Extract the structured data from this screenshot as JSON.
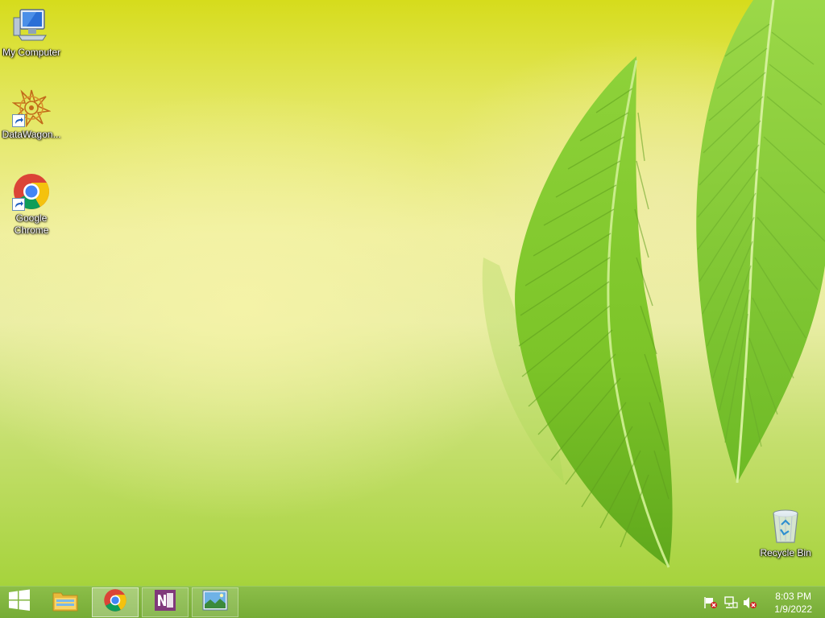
{
  "desktop": {
    "icons": [
      {
        "label": "My Computer",
        "icon": "computer-icon"
      },
      {
        "label": "DataWagon...",
        "icon": "datawagon-icon",
        "shortcut": true
      },
      {
        "label": "Google Chrome",
        "icon": "chrome-icon",
        "shortcut": true
      },
      {
        "label": "Recycle Bin",
        "icon": "recycle-bin-icon"
      }
    ]
  },
  "taskbar": {
    "start_icon": "windows-logo-icon",
    "apps": [
      {
        "name": "file-explorer",
        "icon": "folder-icon",
        "state": "pinned"
      },
      {
        "name": "google-chrome",
        "icon": "chrome-icon",
        "state": "active"
      },
      {
        "name": "onenote",
        "icon": "onenote-icon",
        "state": "pinned"
      },
      {
        "name": "image-viewer",
        "icon": "picture-icon",
        "state": "pinned"
      }
    ],
    "tray": {
      "icons": [
        "action-center-flag-icon",
        "network-icon",
        "volume-muted-icon"
      ],
      "time": "8:03 PM",
      "date": "1/9/2022"
    }
  },
  "colors": {
    "taskbar": "#7fb43e",
    "onenote": "#80397b",
    "chrome_red": "#db4437",
    "chrome_yellow": "#f4c20d",
    "chrome_green": "#0f9d58",
    "chrome_blue": "#4285f4"
  }
}
